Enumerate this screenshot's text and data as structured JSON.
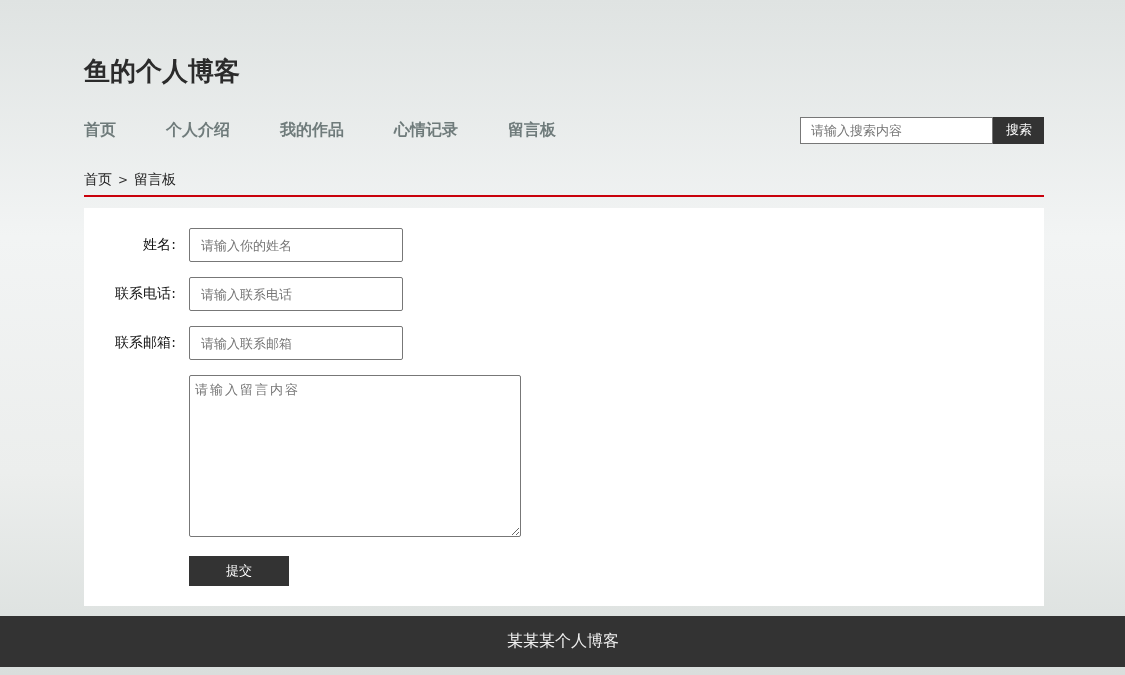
{
  "site_title": "鱼的个人博客",
  "nav": [
    {
      "label": "首页"
    },
    {
      "label": "个人介绍"
    },
    {
      "label": "我的作品"
    },
    {
      "label": "心情记录"
    },
    {
      "label": "留言板"
    }
  ],
  "search": {
    "placeholder": "请输入搜索内容",
    "button": "搜索"
  },
  "breadcrumb": [
    {
      "label": "首页"
    },
    {
      "label": ">",
      "kind": "separator"
    },
    {
      "label": "留言板"
    }
  ],
  "form": {
    "fields": [
      {
        "label": "姓名:",
        "placeholder": "请输入你的姓名"
      },
      {
        "label": "联系电话:",
        "placeholder": "请输入联系电话"
      },
      {
        "label": "联系邮箱:",
        "placeholder": "请输入联系邮箱"
      }
    ],
    "message": {
      "placeholder": "请输入留言内容"
    },
    "submit": "提交"
  },
  "footer": "某某某个人博客"
}
